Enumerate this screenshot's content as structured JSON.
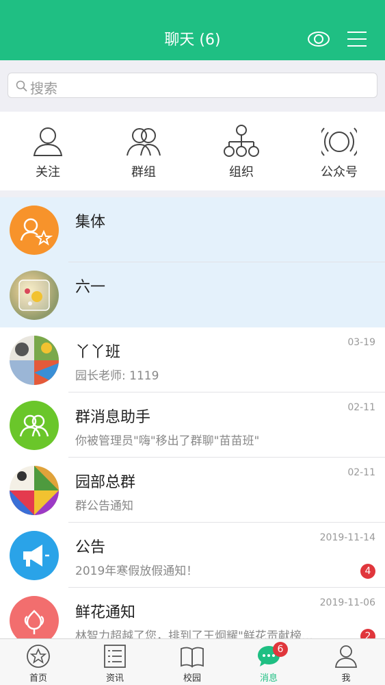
{
  "header": {
    "title": "聊天 (6)"
  },
  "search": {
    "placeholder": "搜索"
  },
  "quick_actions": [
    {
      "label": "关注",
      "icon": "person-icon"
    },
    {
      "label": "群组",
      "icon": "group-icon"
    },
    {
      "label": "组织",
      "icon": "org-chart-icon"
    },
    {
      "label": "公众号",
      "icon": "broadcast-icon"
    }
  ],
  "chats": [
    {
      "name": "集体",
      "subtitle": "",
      "time": "",
      "badge": "",
      "pinned": true
    },
    {
      "name": "六一",
      "subtitle": "",
      "time": "",
      "badge": "",
      "pinned": true
    },
    {
      "name": "丫丫班",
      "subtitle": "园长老师: 1119",
      "time": "03-19",
      "badge": ""
    },
    {
      "name": "群消息助手",
      "subtitle": "你被管理员\"嗨\"移出了群聊\"苗苗班\"",
      "time": "02-11",
      "badge": ""
    },
    {
      "name": "园部总群",
      "subtitle": "群公告通知",
      "time": "02-11",
      "badge": ""
    },
    {
      "name": "公告",
      "subtitle": "2019年寒假放假通知！",
      "time": "2019-11-14",
      "badge": "4"
    },
    {
      "name": "鲜花通知",
      "subtitle": "林智力超越了您，排到了王炯耀\"鲜花贡献榜…",
      "time": "2019-11-06",
      "badge": "2"
    }
  ],
  "tabbar": {
    "items": [
      {
        "label": "首页",
        "icon": "star-circle-icon"
      },
      {
        "label": "资讯",
        "icon": "news-list-icon"
      },
      {
        "label": "校园",
        "icon": "book-icon"
      },
      {
        "label": "消息",
        "icon": "chat-bubble-icon",
        "badge": "6"
      },
      {
        "label": "我",
        "icon": "person-icon"
      }
    ]
  },
  "colors": {
    "brand": "#1fbf83",
    "badge": "#e0363c",
    "pinned_bg": "#e4f1fb"
  }
}
